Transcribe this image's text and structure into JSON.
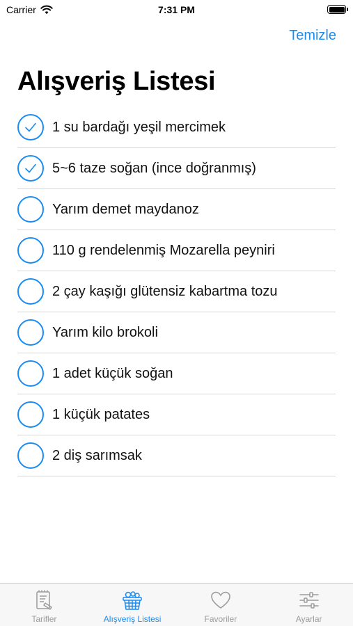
{
  "status_bar": {
    "carrier": "Carrier",
    "time": "7:31 PM"
  },
  "nav": {
    "action_label": "Temizle"
  },
  "page_title": "Alışveriş Listesi",
  "items": [
    {
      "label": "1 su bardağı yeşil mercimek",
      "checked": true
    },
    {
      "label": "5~6 taze soğan (ince doğranmış)",
      "checked": true
    },
    {
      "label": "Yarım demet maydanoz",
      "checked": false
    },
    {
      "label": "110 g rendelenmiş Mozarella peyniri",
      "checked": false
    },
    {
      "label": "2 çay kaşığı glütensiz kabartma tozu",
      "checked": false
    },
    {
      "label": "Yarım kilo brokoli",
      "checked": false
    },
    {
      "label": "1 adet küçük soğan",
      "checked": false
    },
    {
      "label": "1 küçük patates",
      "checked": false
    },
    {
      "label": "2 diş sarımsak",
      "checked": false
    }
  ],
  "tabs": [
    {
      "label": "Tarifler",
      "icon": "recipe-book-icon",
      "active": false
    },
    {
      "label": "Alışveriş Listesi",
      "icon": "shopping-basket-icon",
      "active": true
    },
    {
      "label": "Favoriler",
      "icon": "heart-icon",
      "active": false
    },
    {
      "label": "Ayarlar",
      "icon": "sliders-icon",
      "active": false
    }
  ],
  "colors": {
    "accent": "#1a8cf0",
    "inactive": "#9b9b9b",
    "separator": "#d6d6d6"
  }
}
